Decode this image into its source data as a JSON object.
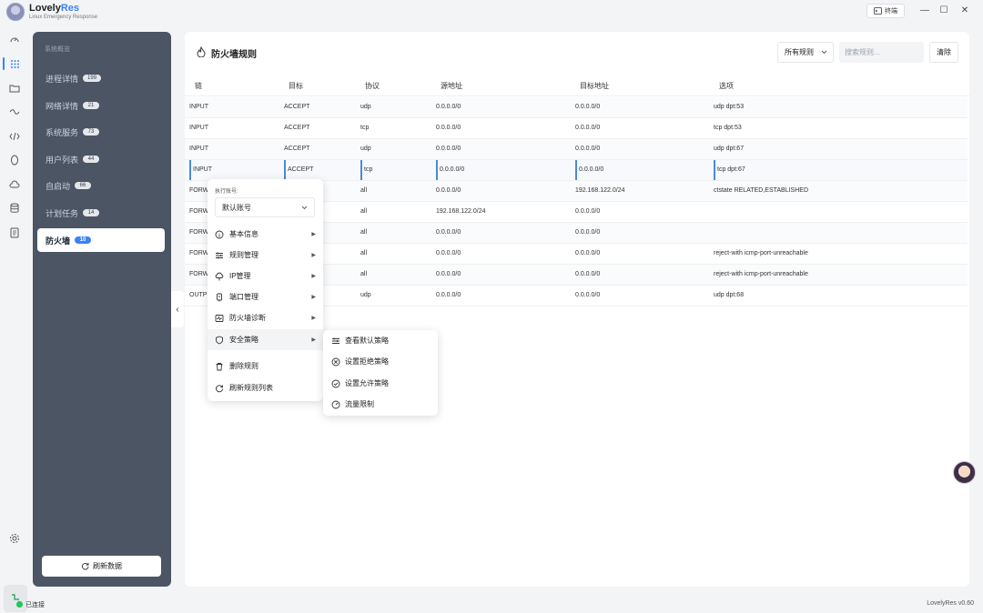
{
  "app": {
    "name_prefix": "Lovely",
    "name_suffix": "Res",
    "subtitle": "Linux Emergency Response",
    "terminal_label": "终端",
    "minimize": "—",
    "maximize": "☐",
    "close": "✕"
  },
  "sidebar": {
    "title": "系统概览",
    "items": [
      {
        "label": "进程详情",
        "count": "199"
      },
      {
        "label": "网络详情",
        "count": "21"
      },
      {
        "label": "系统服务",
        "count": "73"
      },
      {
        "label": "用户列表",
        "count": "44"
      },
      {
        "label": "自启动",
        "count": "66"
      },
      {
        "label": "计划任务",
        "count": "14"
      },
      {
        "label": "防火墙",
        "count": "10"
      }
    ],
    "active_index": 6,
    "refresh_label": "刷新数据",
    "collapse_icon": "‹"
  },
  "panel": {
    "title": "防火墙规则",
    "filter_value": "所有规则",
    "search_placeholder": "搜索规则...",
    "clear_label": "清除"
  },
  "table": {
    "headers": [
      "链",
      "目标",
      "协议",
      "源地址",
      "目标地址",
      "选项"
    ],
    "rows": [
      [
        "INPUT",
        "ACCEPT",
        "udp",
        "0.0.0.0/0",
        "0.0.0.0/0",
        "udp dpt:53"
      ],
      [
        "INPUT",
        "ACCEPT",
        "tcp",
        "0.0.0.0/0",
        "0.0.0.0/0",
        "tcp dpt:53"
      ],
      [
        "INPUT",
        "ACCEPT",
        "udp",
        "0.0.0.0/0",
        "0.0.0.0/0",
        "udp dpt:67"
      ],
      [
        "INPUT",
        "ACCEPT",
        "tcp",
        "0.0.0.0/0",
        "0.0.0.0/0",
        "tcp dpt:67"
      ],
      [
        "FORW",
        "",
        "all",
        "0.0.0.0/0",
        "192.168.122.0/24",
        "ctstate RELATED,ESTABLISHED"
      ],
      [
        "FORW",
        "",
        "all",
        "192.168.122.0/24",
        "0.0.0.0/0",
        ""
      ],
      [
        "FORW",
        "",
        "all",
        "0.0.0.0/0",
        "0.0.0.0/0",
        ""
      ],
      [
        "FORW",
        "",
        "all",
        "0.0.0.0/0",
        "0.0.0.0/0",
        "reject-with icmp-port-unreachable"
      ],
      [
        "FORW",
        "",
        "all",
        "0.0.0.0/0",
        "0.0.0.0/0",
        "reject-with icmp-port-unreachable"
      ],
      [
        "OUTP",
        "",
        "udp",
        "0.0.0.0/0",
        "0.0.0.0/0",
        "udp dpt:68"
      ]
    ],
    "selected_row": 3
  },
  "context_menu": {
    "account_label": "执行账号:",
    "account_value": "默认账号",
    "items": [
      {
        "label": "基本信息",
        "icon": "info-icon"
      },
      {
        "label": "规则管理",
        "icon": "sliders-icon"
      },
      {
        "label": "IP管理",
        "icon": "cloud-icon"
      },
      {
        "label": "端口管理",
        "icon": "port-icon"
      },
      {
        "label": "防火墙诊断",
        "icon": "diagnose-icon"
      },
      {
        "label": "安全策略",
        "icon": "shield-icon"
      }
    ],
    "actions": [
      {
        "label": "删除规则",
        "icon": "trash-icon"
      },
      {
        "label": "刷新规则列表",
        "icon": "refresh-icon"
      }
    ],
    "submenu": [
      {
        "label": "查看默认策略",
        "icon": "list-icon"
      },
      {
        "label": "设置拒绝策略",
        "icon": "deny-icon"
      },
      {
        "label": "设置允许策略",
        "icon": "allow-icon"
      },
      {
        "label": "流量限制",
        "icon": "gauge-icon"
      }
    ]
  },
  "status": {
    "connection": "已连接",
    "version": "LovelyRes v0.60"
  },
  "colors": {
    "accent": "#3b82f6",
    "sidebar_bg": "#4b5563",
    "connected": "#22c55e"
  }
}
